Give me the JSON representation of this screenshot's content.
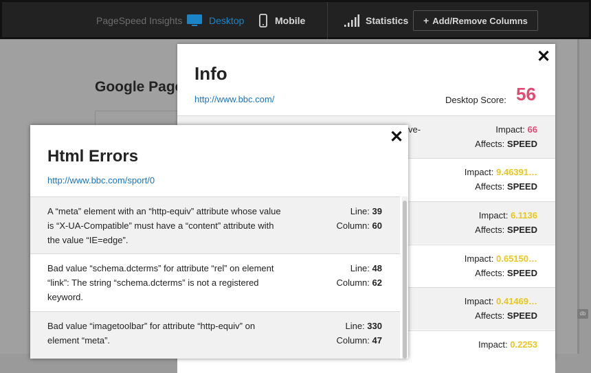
{
  "topbar": {
    "brand": "PageSpeed Insights",
    "desktop_label": "Desktop",
    "mobile_label": "Mobile",
    "statistics_label": "Statistics",
    "add_remove_label": "Add/Remove Columns",
    "add_remove_plus": "+"
  },
  "background": {
    "title": "Google Page"
  },
  "info_modal": {
    "title": "Info",
    "url": "http://www.bbc.com/",
    "score_label": "Desktop Score:",
    "score": "56",
    "close": "✕",
    "rows": [
      {
        "fragment": "ve-",
        "impact_label": "Impact:",
        "impact": "66",
        "affects_label": "Affects:",
        "affects": "SPEED"
      },
      {
        "impact_label": "Impact:",
        "impact": "9.46391…",
        "affects_label": "Affects:",
        "affects": "SPEED"
      },
      {
        "impact_label": "Impact:",
        "impact": "6.1136",
        "affects_label": "Affects:",
        "affects": "SPEED"
      },
      {
        "impact_label": "Impact:",
        "impact": "0.65150…",
        "affects_label": "Affects:",
        "affects": "SPEED"
      },
      {
        "impact_label": "Impact:",
        "impact": "0.41469…",
        "affects_label": "Affects:",
        "affects": "SPEED"
      },
      {
        "impact_label": "Impact:",
        "impact": "0.2253"
      }
    ]
  },
  "errors_modal": {
    "title": "Html Errors",
    "url": "http://www.bbc.com/sport/0",
    "close": "✕",
    "rows": [
      {
        "message": "A “meta” element with an “http-equiv” attribute whose value is “X-UA-Compatible” must have a “content” attribute with the value “IE=edge”.",
        "line_label": "Line:",
        "line": "39",
        "column_label": "Column:",
        "column": "60"
      },
      {
        "message": "Bad value “schema.dcterms” for attribute “rel” on element “link”: The string “schema.dcterms” is not a registered keyword.",
        "line_label": "Line:",
        "line": "48",
        "column_label": "Column:",
        "column": "62"
      },
      {
        "message": "Bad value “imagetoolbar” for attribute “http-equiv” on element “meta”.",
        "line_label": "Line:",
        "line": "330",
        "column_label": "Column:",
        "column": "47"
      }
    ]
  },
  "colors": {
    "accent_blue": "#1a84c7",
    "score_pink": "#e14a72",
    "impact_yellow": "#e8c61e"
  }
}
